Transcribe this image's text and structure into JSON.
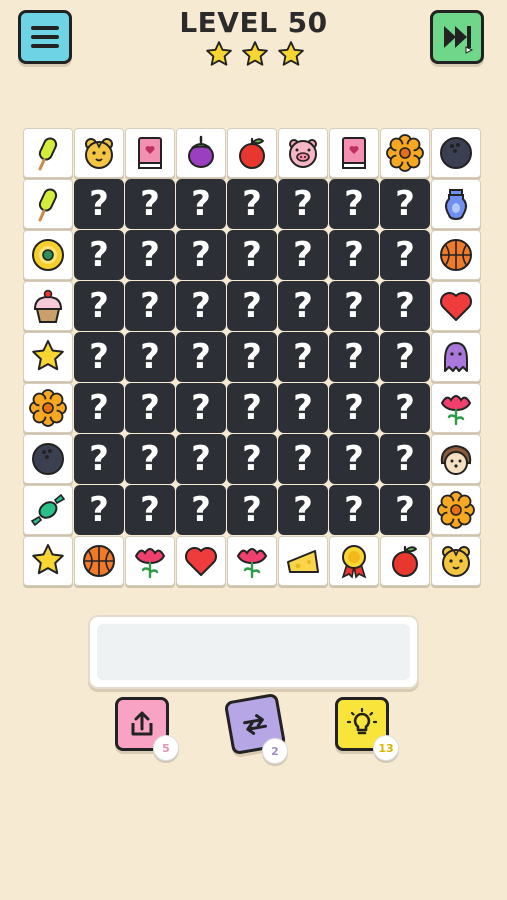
{
  "header": {
    "level_title": "LEVEL 50",
    "stars_earned": 3,
    "menu_icon": "hamburger-icon",
    "skip_icon": "fast-forward-video-icon"
  },
  "board": {
    "hidden_symbol": "?",
    "top_row": [
      "popsicle",
      "tiger",
      "book",
      "eggplant",
      "apple",
      "pig",
      "book",
      "flower",
      "bowling-ball"
    ],
    "left_col": [
      "popsicle",
      "pineapple-slice",
      "cupcake",
      "star",
      "flower",
      "bowling-ball",
      "candy"
    ],
    "right_col": [
      "jug",
      "basketball",
      "heart",
      "octopus",
      "carnation",
      "hedgehog",
      "flower"
    ],
    "bottom_row": [
      "star",
      "basketball",
      "carnation",
      "heart",
      "carnation",
      "cheese",
      "medal",
      "apple",
      "tiger"
    ]
  },
  "powerups": {
    "undo": {
      "count": "5",
      "color": "#f9a3c4",
      "icon": "share-arrow-icon"
    },
    "shuffle": {
      "count": "2",
      "color": "#b6a6e6",
      "icon": "shuffle-icon"
    },
    "hint": {
      "count": "13",
      "color": "#f8e43a",
      "icon": "lightbulb-icon"
    }
  }
}
